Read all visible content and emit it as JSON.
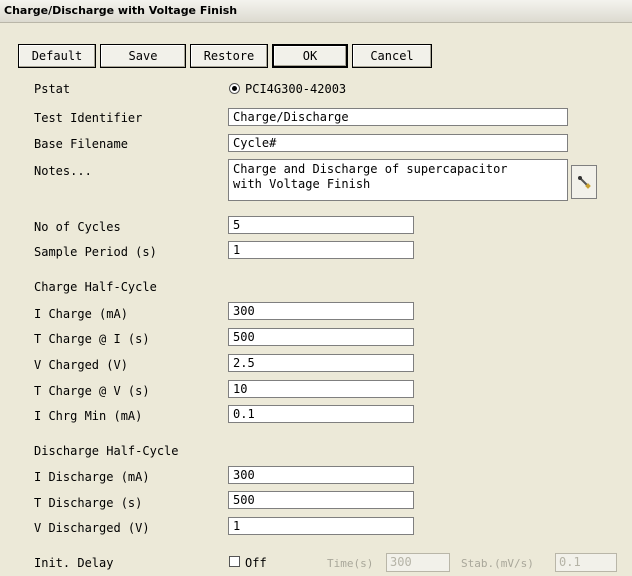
{
  "window": {
    "title": "Charge/Discharge with Voltage Finish"
  },
  "toolbar": {
    "default_label": "Default",
    "save_label": "Save",
    "restore_label": "Restore",
    "ok_label": "OK",
    "cancel_label": "Cancel"
  },
  "pstat": {
    "label": "Pstat",
    "value": "PCI4G300-42003",
    "selected": true
  },
  "test_identifier": {
    "label": "Test Identifier",
    "value": "Charge/Discharge"
  },
  "base_filename": {
    "label": "Base Filename",
    "value": "Cycle#"
  },
  "notes": {
    "label": "Notes...",
    "value": "Charge and Discharge of supercapacitor\nwith Voltage Finish",
    "edit_icon": "edit-icon"
  },
  "no_of_cycles": {
    "label": "No of Cycles",
    "value": "5"
  },
  "sample_period": {
    "label": "Sample Period (s)",
    "value": "1"
  },
  "charge": {
    "heading": "Charge Half-Cycle",
    "i_charge": {
      "label": "I Charge (mA)",
      "value": "300"
    },
    "t_charge_i": {
      "label": "T Charge @ I (s)",
      "value": "500"
    },
    "v_charged": {
      "label": "V Charged (V)",
      "value": "2.5"
    },
    "t_charge_v": {
      "label": "T Charge @ V (s)",
      "value": "10"
    },
    "i_chrg_min": {
      "label": "I Chrg Min (mA)",
      "value": "0.1"
    }
  },
  "discharge": {
    "heading": "Discharge Half-Cycle",
    "i_discharge": {
      "label": "I Discharge (mA)",
      "value": "300"
    },
    "t_discharge": {
      "label": "T Discharge (s)",
      "value": "500"
    },
    "v_discharged": {
      "label": "V Discharged (V)",
      "value": "1"
    }
  },
  "init_delay": {
    "label": "Init. Delay",
    "checkbox_label": "Off",
    "checked": false,
    "time_label": "Time(s)",
    "time_value": "300",
    "stab_label": "Stab.(mV/s)",
    "stab_value": "0.1"
  }
}
